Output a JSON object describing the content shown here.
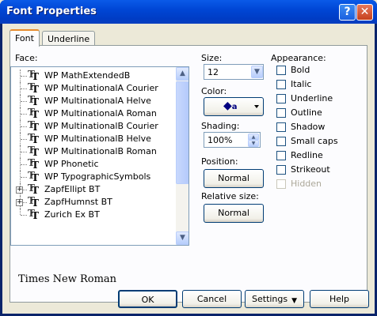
{
  "window": {
    "title": "Font Properties",
    "help_glyph": "?",
    "close_glyph": "✕"
  },
  "tabs": [
    {
      "label": "Font",
      "active": true
    },
    {
      "label": "Underline",
      "active": false
    }
  ],
  "face": {
    "label": "Face:",
    "items": [
      {
        "name": "WP MathExtendedB",
        "expandable": false
      },
      {
        "name": "WP MultinationalA Courier",
        "expandable": false
      },
      {
        "name": "WP MultinationalA Helve",
        "expandable": false
      },
      {
        "name": "WP MultinationalA Roman",
        "expandable": false
      },
      {
        "name": "WP MultinationalB Courier",
        "expandable": false
      },
      {
        "name": "WP MultinationalB Helve",
        "expandable": false
      },
      {
        "name": "WP MultinationalB Roman",
        "expandable": false
      },
      {
        "name": "WP Phonetic",
        "expandable": false
      },
      {
        "name": "WP TypographicSymbols",
        "expandable": false
      },
      {
        "name": "ZapfEllipt BT",
        "expandable": true
      },
      {
        "name": "ZapfHumnst BT",
        "expandable": true
      },
      {
        "name": "Zurich Ex BT",
        "expandable": false
      }
    ]
  },
  "size": {
    "label": "Size:",
    "value": "12"
  },
  "color": {
    "label": "Color:"
  },
  "shading": {
    "label": "Shading:",
    "value": "100%"
  },
  "position": {
    "label": "Position:",
    "value": "Normal"
  },
  "relative_size": {
    "label": "Relative size:",
    "value": "Normal"
  },
  "appearance": {
    "label": "Appearance:",
    "options": [
      {
        "label": "Bold",
        "enabled": true
      },
      {
        "label": "Italic",
        "enabled": true
      },
      {
        "label": "Underline",
        "enabled": true
      },
      {
        "label": "Outline",
        "enabled": true
      },
      {
        "label": "Shadow",
        "enabled": true
      },
      {
        "label": "Small caps",
        "enabled": true
      },
      {
        "label": "Redline",
        "enabled": true
      },
      {
        "label": "Strikeout",
        "enabled": true
      },
      {
        "label": "Hidden",
        "enabled": false
      }
    ]
  },
  "preview_text": "Times New Roman",
  "buttons": {
    "ok": "OK",
    "cancel": "Cancel",
    "settings": "Settings",
    "help": "Help"
  },
  "colors": {
    "title_bar": "#0054e3",
    "face": "#ece9d8",
    "disabled_text": "#aca899"
  }
}
